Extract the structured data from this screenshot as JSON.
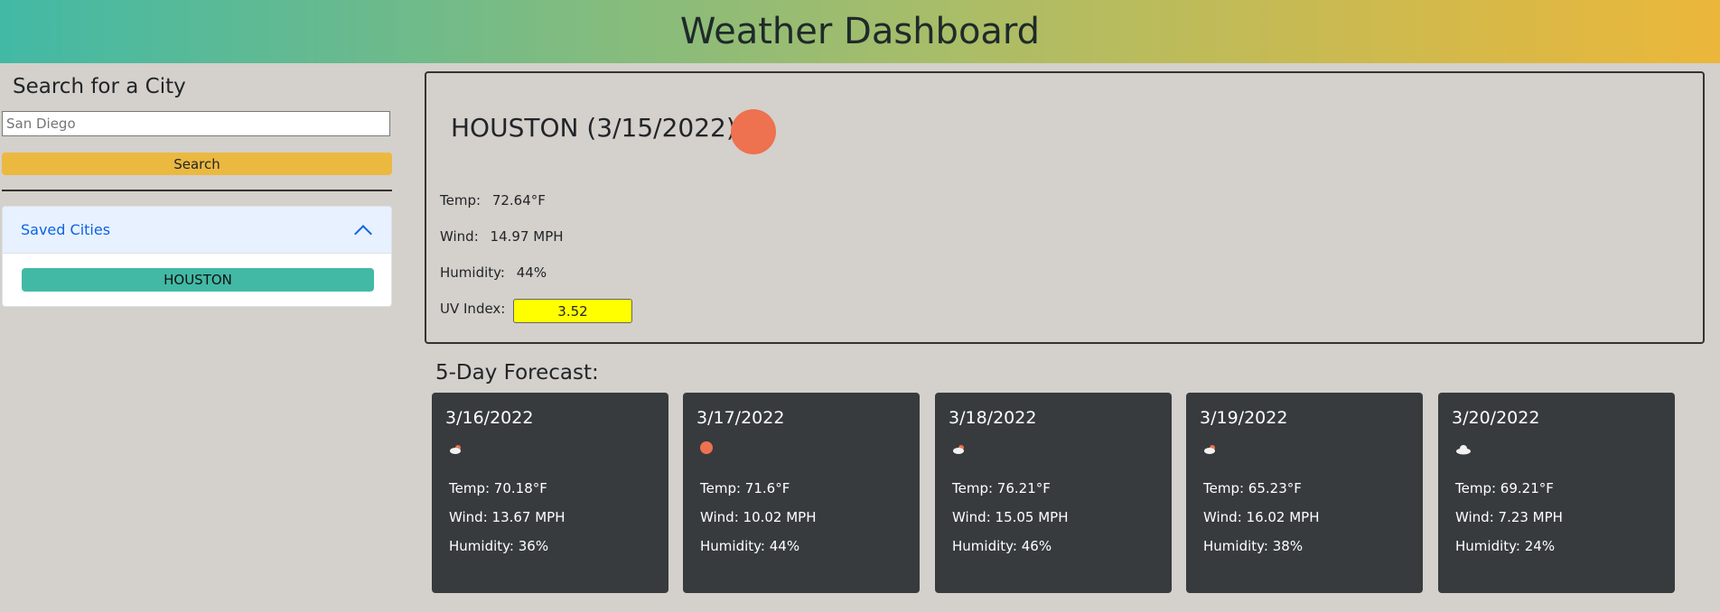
{
  "header": {
    "title": "Weather Dashboard"
  },
  "sidebar": {
    "heading": "Search for a City",
    "search": {
      "value": "",
      "placeholder": "San Diego"
    },
    "search_button_label": "Search",
    "saved_cities": {
      "title": "Saved Cities",
      "expanded": true,
      "items": [
        {
          "label": "HOUSTON"
        }
      ]
    }
  },
  "current": {
    "title": "HOUSTON (3/15/2022)",
    "icon": "sun-icon",
    "icon_color": "#ee7150",
    "temp_label": "Temp:",
    "temp_value": "72.64°F",
    "wind_label": "Wind:",
    "wind_value": "14.97 MPH",
    "humidity_label": "Humidity:",
    "humidity_value": "44%",
    "uv_label": "UV Index:",
    "uv_value": "3.52",
    "uv_color": "#ffff00"
  },
  "forecast": {
    "heading": "5-Day Forecast:",
    "days": [
      {
        "date": "3/16/2022",
        "icon": "partly-cloudy-icon",
        "temp": "Temp: 70.18°F",
        "wind": "Wind: 13.67 MPH",
        "humidity": "Humidity: 36%"
      },
      {
        "date": "3/17/2022",
        "icon": "sun-icon",
        "temp": "Temp: 71.6°F",
        "wind": "Wind: 10.02 MPH",
        "humidity": "Humidity: 44%"
      },
      {
        "date": "3/18/2022",
        "icon": "partly-cloudy-icon",
        "temp": "Temp: 76.21°F",
        "wind": "Wind: 15.05 MPH",
        "humidity": "Humidity: 46%"
      },
      {
        "date": "3/19/2022",
        "icon": "partly-cloudy-icon",
        "temp": "Temp: 65.23°F",
        "wind": "Wind: 16.02 MPH",
        "humidity": "Humidity: 38%"
      },
      {
        "date": "3/20/2022",
        "icon": "cloud-icon",
        "temp": "Temp: 69.21°F",
        "wind": "Wind: 7.23 MPH",
        "humidity": "Humidity: 24%"
      }
    ]
  }
}
